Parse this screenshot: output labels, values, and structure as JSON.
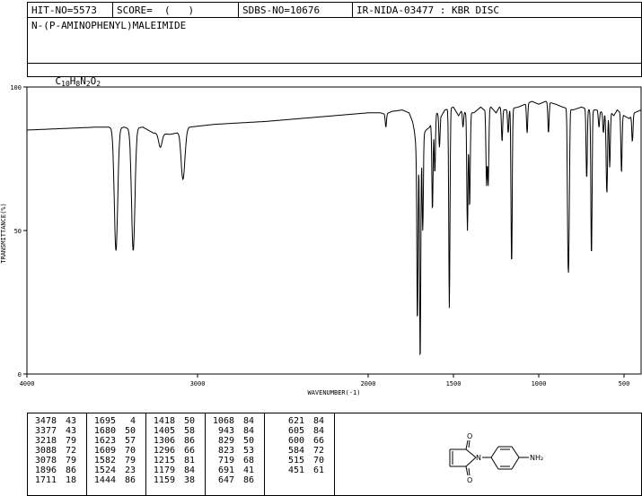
{
  "header": {
    "hit_no": "HIT-NO=5573",
    "score": "SCORE=  (   )",
    "sdbs_no": "SDBS-NO=10676",
    "ir_id": "IR-NIDA-03477 : KBR DISC",
    "compound_name": "N-(P-AMINOPHENYL)MALEIMIDE",
    "formula_parts": [
      "C",
      "10",
      "H",
      "8",
      "N",
      "2",
      "O",
      "2"
    ]
  },
  "chart_data": {
    "type": "line",
    "xlabel": "WAVENUMBER(-1)",
    "ylabel": "TRANSMITTANCE(%)",
    "x_ticks": [
      4000,
      3000,
      2000,
      1500,
      1000,
      500
    ],
    "y_ticks": [
      0,
      50,
      100
    ],
    "xlim": [
      4000,
      400
    ],
    "ylim": [
      0,
      100
    ],
    "grid": false,
    "baseline": [
      [
        4000,
        85
      ],
      [
        3800,
        85.5
      ],
      [
        3600,
        86
      ],
      [
        3520,
        86
      ],
      [
        3490,
        85.5
      ],
      [
        3430,
        86
      ],
      [
        3400,
        85.5
      ],
      [
        3320,
        86
      ],
      [
        3260,
        84
      ],
      [
        3160,
        83.5
      ],
      [
        3120,
        84
      ],
      [
        3050,
        86
      ],
      [
        2900,
        87
      ],
      [
        2600,
        88
      ],
      [
        2400,
        89
      ],
      [
        2200,
        90
      ],
      [
        2000,
        91
      ],
      [
        1930,
        91
      ],
      [
        1900,
        90.5
      ],
      [
        1860,
        91.5
      ],
      [
        1800,
        92
      ],
      [
        1760,
        91
      ],
      [
        1740,
        88
      ],
      [
        1730,
        85
      ],
      [
        1720,
        80
      ],
      [
        1660,
        85
      ],
      [
        1640,
        86
      ],
      [
        1600,
        91
      ],
      [
        1570,
        90
      ],
      [
        1550,
        92
      ],
      [
        1500,
        93
      ],
      [
        1470,
        90
      ],
      [
        1450,
        92
      ],
      [
        1430,
        91
      ],
      [
        1380,
        91
      ],
      [
        1340,
        93
      ],
      [
        1320,
        92
      ],
      [
        1280,
        93
      ],
      [
        1250,
        91
      ],
      [
        1230,
        93
      ],
      [
        1200,
        92
      ],
      [
        1120,
        93
      ],
      [
        1080,
        94
      ],
      [
        1040,
        95
      ],
      [
        1000,
        94
      ],
      [
        960,
        95
      ],
      [
        900,
        94
      ],
      [
        860,
        93
      ],
      [
        800,
        92
      ],
      [
        750,
        93
      ],
      [
        700,
        92
      ],
      [
        660,
        92
      ],
      [
        620,
        91
      ],
      [
        590,
        92
      ],
      [
        560,
        90
      ],
      [
        540,
        92
      ],
      [
        500,
        90
      ],
      [
        470,
        89
      ],
      [
        440,
        91
      ],
      [
        400,
        92
      ]
    ],
    "peaks": [
      {
        "x": 3478,
        "y": 43
      },
      {
        "x": 3377,
        "y": 43
      },
      {
        "x": 3218,
        "y": 79
      },
      {
        "x": 3088,
        "y": 72
      },
      {
        "x": 3078,
        "y": 79
      },
      {
        "x": 1896,
        "y": 86
      },
      {
        "x": 1711,
        "y": 18
      },
      {
        "x": 1695,
        "y": 4
      },
      {
        "x": 1680,
        "y": 50
      },
      {
        "x": 1623,
        "y": 57
      },
      {
        "x": 1609,
        "y": 70
      },
      {
        "x": 1582,
        "y": 79
      },
      {
        "x": 1524,
        "y": 23
      },
      {
        "x": 1444,
        "y": 86
      },
      {
        "x": 1418,
        "y": 50
      },
      {
        "x": 1405,
        "y": 58
      },
      {
        "x": 1306,
        "y": 66
      },
      {
        "x": 1296,
        "y": 66
      },
      {
        "x": 1215,
        "y": 81
      },
      {
        "x": 1179,
        "y": 84
      },
      {
        "x": 1159,
        "y": 38
      },
      {
        "x": 1068,
        "y": 84
      },
      {
        "x": 943,
        "y": 84
      },
      {
        "x": 829,
        "y": 50
      },
      {
        "x": 823,
        "y": 53
      },
      {
        "x": 719,
        "y": 68
      },
      {
        "x": 691,
        "y": 41
      },
      {
        "x": 647,
        "y": 86
      },
      {
        "x": 621,
        "y": 84
      },
      {
        "x": 605,
        "y": 84
      },
      {
        "x": 600,
        "y": 66
      },
      {
        "x": 584,
        "y": 72
      },
      {
        "x": 515,
        "y": 70
      },
      {
        "x": 451,
        "y": 81
      }
    ]
  },
  "peak_table": {
    "columns": [
      [
        [
          "3478",
          "43"
        ],
        [
          "3377",
          "43"
        ],
        [
          "3218",
          "79"
        ],
        [
          "3088",
          "72"
        ],
        [
          "3078",
          "79"
        ],
        [
          "1896",
          "86"
        ],
        [
          "1711",
          "18"
        ]
      ],
      [
        [
          "1695",
          "4"
        ],
        [
          "1680",
          "50"
        ],
        [
          "1623",
          "57"
        ],
        [
          "1609",
          "70"
        ],
        [
          "1582",
          "79"
        ],
        [
          "1524",
          "23"
        ],
        [
          "1444",
          "86"
        ]
      ],
      [
        [
          "1418",
          "50"
        ],
        [
          "1405",
          "58"
        ],
        [
          "1306",
          "86"
        ],
        [
          "1296",
          "66"
        ],
        [
          "1215",
          "81"
        ],
        [
          "1179",
          "84"
        ],
        [
          "1159",
          "38"
        ]
      ],
      [
        [
          "1068",
          "84"
        ],
        [
          "943",
          "84"
        ],
        [
          "829",
          "50"
        ],
        [
          "823",
          "53"
        ],
        [
          "719",
          "68"
        ],
        [
          "691",
          "41"
        ],
        [
          "647",
          "86"
        ]
      ],
      [
        [
          "621",
          "84"
        ],
        [
          "605",
          "84"
        ],
        [
          "600",
          "66"
        ],
        [
          "584",
          "72"
        ],
        [
          "515",
          "70"
        ],
        [
          "451",
          "61"
        ]
      ]
    ]
  },
  "structure": {
    "atom_labels": {
      "o_top": "O",
      "n_ring": "N",
      "o_bottom": "O",
      "amine": "NH₂"
    }
  }
}
